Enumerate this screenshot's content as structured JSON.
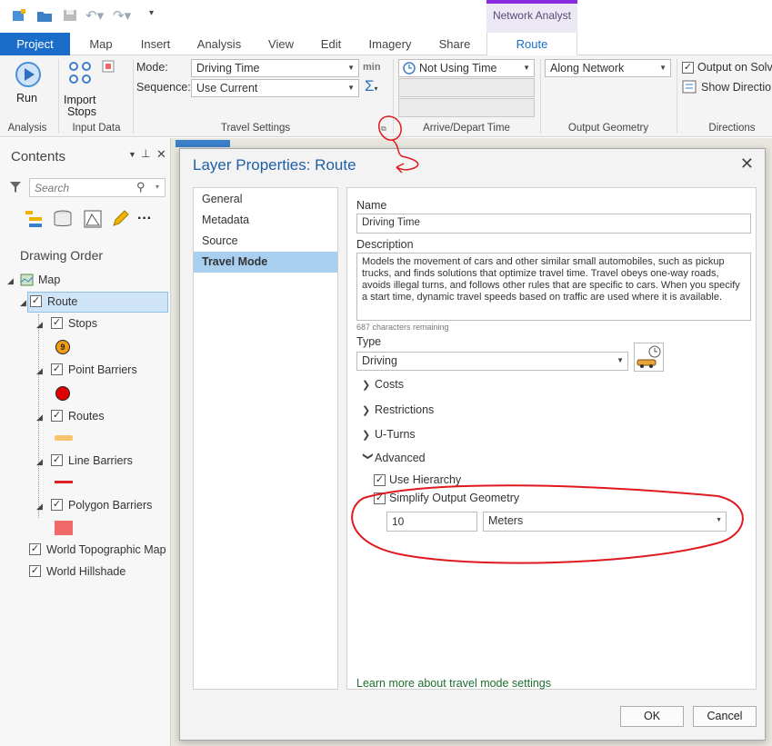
{
  "tabs": {
    "project": "Project",
    "map": "Map",
    "insert": "Insert",
    "analysis": "Analysis",
    "view": "View",
    "edit": "Edit",
    "imagery": "Imagery",
    "share": "Share",
    "context_group": "Network Analyst",
    "route": "Route"
  },
  "ribbon": {
    "run": "Run",
    "import_stops_1": "Import",
    "import_stops_2": "Stops",
    "groups": {
      "analysis": "Analysis",
      "input_data": "Input Data",
      "travel_settings": "Travel Settings",
      "arrive_depart": "Arrive/Depart Time",
      "output_geometry": "Output Geometry",
      "directions": "Directions"
    },
    "mode_label": "Mode:",
    "mode_value": "Driving Time",
    "mode_unit": "min",
    "sequence_label": "Sequence:",
    "sequence_value": "Use Current",
    "time_value": "Not Using Time",
    "output_geometry_value": "Along Network",
    "output_on_solve": "Output on Solve",
    "show_directions": "Show Directions"
  },
  "contents": {
    "title": "Contents",
    "search_placeholder": "Search",
    "drawing_order": "Drawing Order",
    "layers": {
      "map": "Map",
      "route": "Route",
      "stops": "Stops",
      "stops_symbol": "9",
      "point_barriers": "Point Barriers",
      "routes": "Routes",
      "line_barriers": "Line Barriers",
      "polygon_barriers": "Polygon Barriers",
      "world_topo": "World Topographic Map",
      "world_hillshade": "World Hillshade"
    }
  },
  "dialog": {
    "title": "Layer Properties: Route",
    "nav": [
      "General",
      "Metadata",
      "Source",
      "Travel Mode"
    ],
    "name_label": "Name",
    "name_value": "Driving Time",
    "description_label": "Description",
    "description_value": "Models the movement of cars and other similar small automobiles, such as pickup trucks, and finds solutions that optimize travel time. Travel obeys one-way roads, avoids illegal turns, and follows other rules that are specific to cars. When you specify a start time, dynamic travel speeds based on traffic are used where it is available.",
    "chars_remaining": "687 characters remaining",
    "type_label": "Type",
    "type_value": "Driving",
    "sections": [
      "Costs",
      "Restrictions",
      "U-Turns",
      "Advanced"
    ],
    "use_hierarchy": "Use Hierarchy",
    "simplify_output": "Simplify Output Geometry",
    "simplify_value": "10",
    "simplify_unit": "Meters",
    "learn_more": "Learn more about travel mode settings",
    "ok": "OK",
    "cancel": "Cancel"
  },
  "colors": {
    "accent": "#1a6dc9",
    "context": "#8a2be2",
    "annotation": "#e0191e",
    "stops": "#f39c12",
    "point_barriers": "#e00000",
    "routes": "#f7c46c",
    "line_barriers": "#e02020",
    "polygon_barriers": "#f06a6a"
  }
}
